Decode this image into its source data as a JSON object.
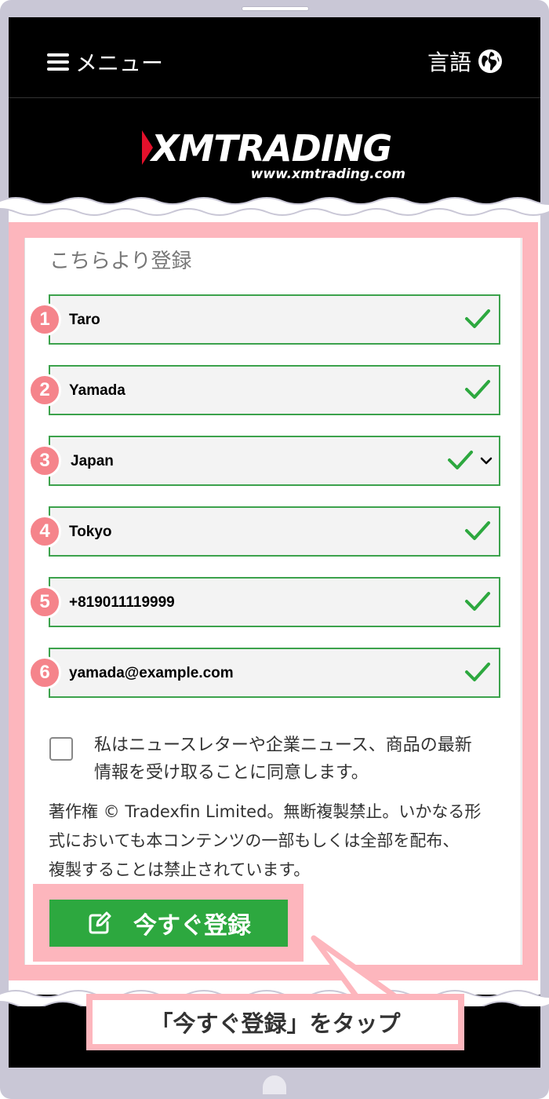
{
  "header": {
    "menu_label": "メニュー",
    "language_label": "言語",
    "logo_text": "XMTRADING",
    "logo_url_text": "www.xmtrading.com"
  },
  "form": {
    "title": "こちらより登録",
    "fields": [
      {
        "step": "1",
        "value": "Taro",
        "type": "text",
        "valid": true
      },
      {
        "step": "2",
        "value": "Yamada",
        "type": "text",
        "valid": true
      },
      {
        "step": "3",
        "value": "Japan",
        "type": "select",
        "valid": true
      },
      {
        "step": "4",
        "value": "Tokyo",
        "type": "text",
        "valid": true
      },
      {
        "step": "5",
        "value": "+819011119999",
        "type": "tel",
        "valid": true
      },
      {
        "step": "6",
        "value": "yamada@example.com",
        "type": "email",
        "valid": true
      }
    ],
    "consent_text_line1": "私はニュースレターや企業ニュース、商品の最新",
    "consent_text_line2": "情報を受け取ることに同意します。",
    "consent_checked": false,
    "copyright_line1": "著作権 © Tradexfin Limited。無断複製禁止。いかなる形",
    "copyright_line2": "式においても本コンテンツの一部もしくは全部を配布、",
    "copyright_line3": "複製することは禁止されています。",
    "submit_label": "今すぐ登録"
  },
  "annotation": {
    "callout_text": "「今すぐ登録」をタップ"
  },
  "colors": {
    "accent_green": "#2da83f",
    "highlight_pink": "#fdb6bd",
    "badge_pink": "#f5848b",
    "logo_red": "#e3102b"
  },
  "icons": {
    "menu": "hamburger-icon",
    "language": "globe-icon",
    "valid": "checkmark-icon",
    "dropdown": "chevron-down-icon",
    "submit": "pencil-edit-icon"
  }
}
